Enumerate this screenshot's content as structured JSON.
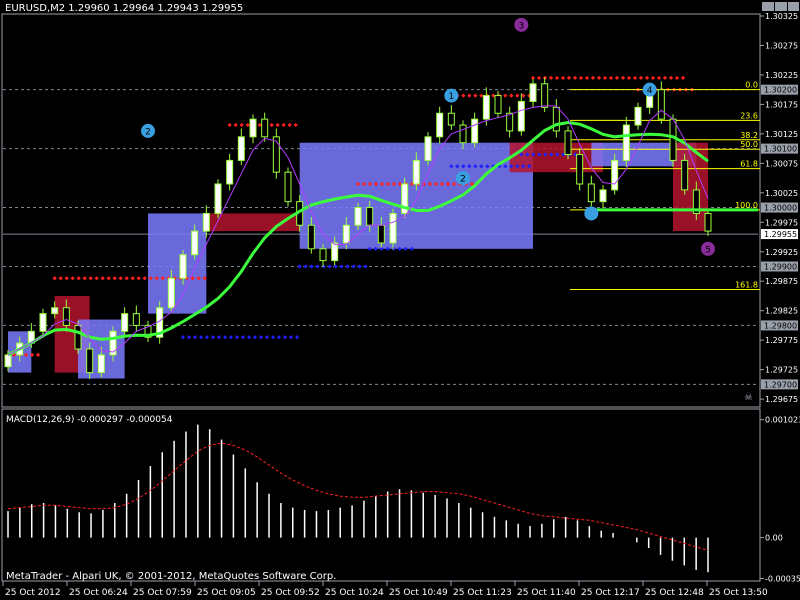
{
  "header": {
    "title": "EURUSD,M2  1.29960 1.29964 1.29943 1.29955",
    "macd_label": "MACD(12,26,9) -0.000297 -0.000054",
    "footer": "MetaTrader - Alpari UK, © 2001-2012, MetaQuotes Software Corp."
  },
  "colors": {
    "bg": "#000000",
    "grid": "#7f8796",
    "candle": "#9cff3c",
    "candle_fill": "#ffffff",
    "blue_box": "#7b7bff",
    "red_box": "#b4142e",
    "ma_green": "#3cff3c",
    "ma_purple": "#b43cff",
    "red_dots": "#ff2020",
    "blue_dots": "#2020ff",
    "fib": "#ffff00",
    "macd_signal": "#ff2020",
    "label_circle_blue": "#3a9fe0",
    "label_circle_purple": "#8a2c9c"
  },
  "chart_data": {
    "type": "candlestick",
    "symbol": "EURUSD",
    "timeframe": "M2",
    "ylim": [
      1.29665,
      1.30325
    ],
    "y_ticks": [
      "1.30325",
      "1.30275",
      "1.30225",
      "1.30175",
      "1.30125",
      "1.30075",
      "1.30025",
      "1.29975",
      "1.29925",
      "1.29875",
      "1.29825",
      "1.29775",
      "1.29725",
      "1.29675"
    ],
    "x_ticks": [
      "25 Oct 2012",
      "25 Oct 06:24",
      "25 Oct 07:59",
      "25 Oct 09:05",
      "25 Oct 09:52",
      "25 Oct 10:24",
      "25 Oct 10:49",
      "25 Oct 11:23",
      "25 Oct 11:40",
      "25 Oct 12:17",
      "25 Oct 12:48",
      "25 Oct 13:50"
    ],
    "price_levels": [
      {
        "value": 1.302,
        "label": "1.30200"
      },
      {
        "value": 1.301,
        "label": "1.30100"
      },
      {
        "value": 1.3,
        "label": "1.30000"
      },
      {
        "value": 1.29955,
        "label": "1.29955",
        "current": true
      },
      {
        "value": 1.299,
        "label": "1.29900"
      },
      {
        "value": 1.298,
        "label": "1.29800"
      },
      {
        "value": 1.297,
        "label": "1.29700"
      }
    ],
    "fib_levels": [
      {
        "label": "0.0",
        "value": 1.302
      },
      {
        "label": "23.6",
        "value": 1.30148
      },
      {
        "label": "38.2",
        "value": 1.30115
      },
      {
        "label": "50.0",
        "value": 1.30099
      },
      {
        "label": "61.8",
        "value": 1.30066
      },
      {
        "label": "100.0",
        "value": 1.29996
      },
      {
        "label": "161.8",
        "value": 1.29861
      }
    ],
    "closes": [
      1.2975,
      1.2977,
      1.2979,
      1.2982,
      1.2983,
      1.298,
      1.2976,
      1.2972,
      1.2975,
      1.2979,
      1.2982,
      1.298,
      1.2978,
      1.2983,
      1.2988,
      1.2992,
      1.2996,
      1.2999,
      1.3004,
      1.3008,
      1.3012,
      1.3015,
      1.3012,
      1.3006,
      1.3001,
      1.2997,
      1.2993,
      1.2991,
      1.2994,
      1.2997,
      1.3,
      1.2997,
      1.2994,
      1.2999,
      1.3004,
      1.3008,
      1.3012,
      1.3016,
      1.3014,
      1.3011,
      1.3015,
      1.3019,
      1.3016,
      1.3013,
      1.3018,
      1.3021,
      1.3017,
      1.3013,
      1.3009,
      1.3004,
      1.3001,
      1.3003,
      1.3008,
      1.3014,
      1.3017,
      1.302,
      1.3015,
      1.3008,
      1.3003,
      1.2999,
      1.2996
    ],
    "macd_ylim": [
      -0.00035,
      0.00102
    ],
    "macd_ticks": [
      "0.001023",
      "0.00",
      "-0.000354"
    ],
    "macd_hist": [
      0.00023,
      0.00026,
      0.00029,
      0.0003,
      0.00028,
      0.00025,
      0.00022,
      0.00021,
      0.00024,
      0.0003,
      0.00038,
      0.0005,
      0.00062,
      0.00074,
      0.00084,
      0.00092,
      0.00098,
      0.00094,
      0.00085,
      0.00072,
      0.0006,
      0.00048,
      0.00038,
      0.0003,
      0.00026,
      0.00024,
      0.00023,
      0.00024,
      0.00026,
      0.00028,
      0.00032,
      0.00036,
      0.0004,
      0.00042,
      0.00041,
      0.00039,
      0.00037,
      0.00034,
      0.0003,
      0.00026,
      0.00022,
      0.00018,
      0.00015,
      0.00012,
      0.0001,
      0.00012,
      0.00016,
      0.00018,
      0.00015,
      0.0001,
      6e-05,
      4e-05,
      0.0,
      -4e-05,
      -9e-05,
      -0.00015,
      -0.0002,
      -0.00024,
      -0.00028,
      -0.0003
    ],
    "macd_signal": [
      0.00025,
      0.00026,
      0.00027,
      0.00028,
      0.00028,
      0.00027,
      0.00026,
      0.00025,
      0.00025,
      0.00026,
      0.00029,
      0.00034,
      0.00041,
      0.00049,
      0.00058,
      0.00067,
      0.00075,
      0.0008,
      0.00082,
      0.0008,
      0.00076,
      0.0007,
      0.00063,
      0.00056,
      0.0005,
      0.00045,
      0.00041,
      0.00038,
      0.00036,
      0.00035,
      0.00035,
      0.00036,
      0.00037,
      0.00038,
      0.00039,
      0.0004,
      0.0004,
      0.00039,
      0.00038,
      0.00036,
      0.00033,
      0.0003,
      0.00027,
      0.00024,
      0.00021,
      0.00019,
      0.00018,
      0.00017,
      0.00016,
      0.00015,
      0.00013,
      0.00011,
      9e-05,
      7e-05,
      4e-05,
      1e-05,
      -2e-05,
      -5e-05,
      -8e-05,
      -0.00011
    ]
  }
}
